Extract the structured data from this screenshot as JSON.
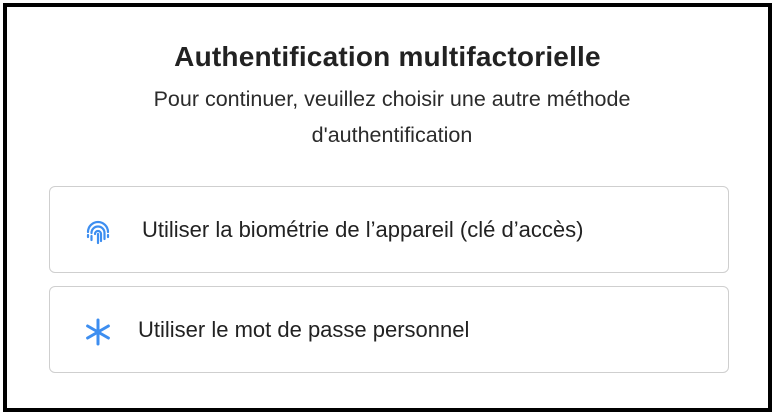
{
  "dialog": {
    "title": "Authentification multifactorielle",
    "subtitle": "Pour continuer, veuillez choisir une autre méthode d'authentification"
  },
  "options": [
    {
      "label": "Utiliser la biométrie de l’appareil (clé d’accès)",
      "icon": "fingerprint-icon"
    },
    {
      "label": "Utiliser le mot de passe personnel",
      "icon": "asterisk-icon"
    }
  ],
  "colors": {
    "accent": "#3d8ef0",
    "border": "#cfcfcf",
    "frame": "#000000"
  }
}
